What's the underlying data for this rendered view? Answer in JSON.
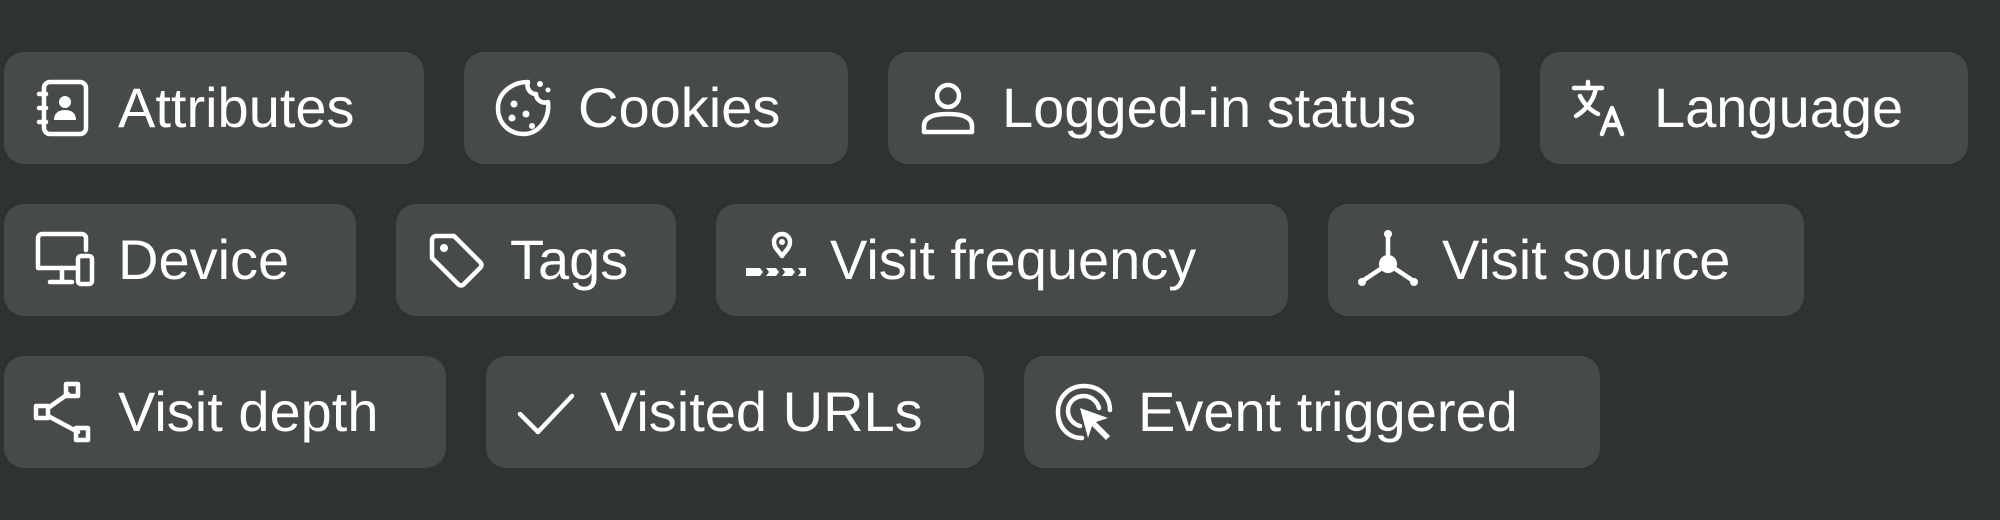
{
  "filters": [
    {
      "label": "Attributes",
      "icon": "contact-book-icon"
    },
    {
      "label": "Cookies",
      "icon": "cookie-icon"
    },
    {
      "label": "Logged-in status",
      "icon": "user-icon"
    },
    {
      "label": "Language",
      "icon": "translate-icon"
    },
    {
      "label": "Device",
      "icon": "devices-icon"
    },
    {
      "label": "Tags",
      "icon": "tag-icon"
    },
    {
      "label": "Visit frequency",
      "icon": "route-pin-icon"
    },
    {
      "label": "Visit source",
      "icon": "network-hub-icon"
    },
    {
      "label": "Visit depth",
      "icon": "hierarchy-icon"
    },
    {
      "label": "Visited URLs",
      "icon": "checkmark-icon"
    },
    {
      "label": "Event triggered",
      "icon": "click-target-icon"
    }
  ],
  "colors": {
    "background": "#2f3232",
    "chip": "#464a49",
    "text": "#ffffff"
  }
}
